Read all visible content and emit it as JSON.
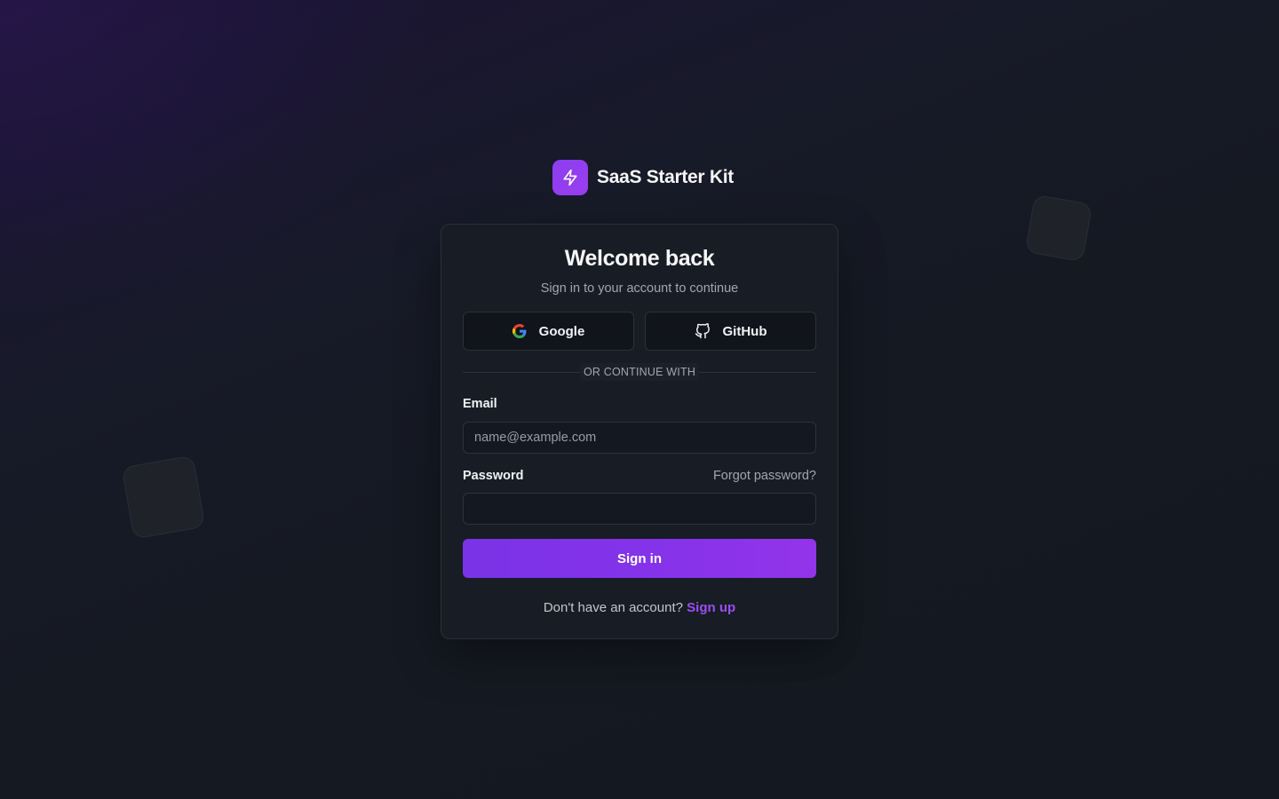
{
  "brand": {
    "name": "SaaS Starter Kit",
    "logo_icon": "lightning-bolt-icon",
    "accent_color": "#8b3ff0"
  },
  "card": {
    "title": "Welcome back",
    "subtitle": "Sign in to your account to continue"
  },
  "oauth": {
    "google_label": "Google",
    "google_icon": "google-icon",
    "github_label": "GitHub",
    "github_icon": "github-icon"
  },
  "divider": {
    "label": "OR CONTINUE WITH"
  },
  "form": {
    "email_label": "Email",
    "email_placeholder": "name@example.com",
    "email_value": "",
    "password_label": "Password",
    "password_value": "",
    "forgot_label": "Forgot password?",
    "submit_label": "Sign in"
  },
  "footer": {
    "prompt": "Don't have an account?",
    "link_label": "Sign up",
    "link_color": "#9b4ef2"
  }
}
